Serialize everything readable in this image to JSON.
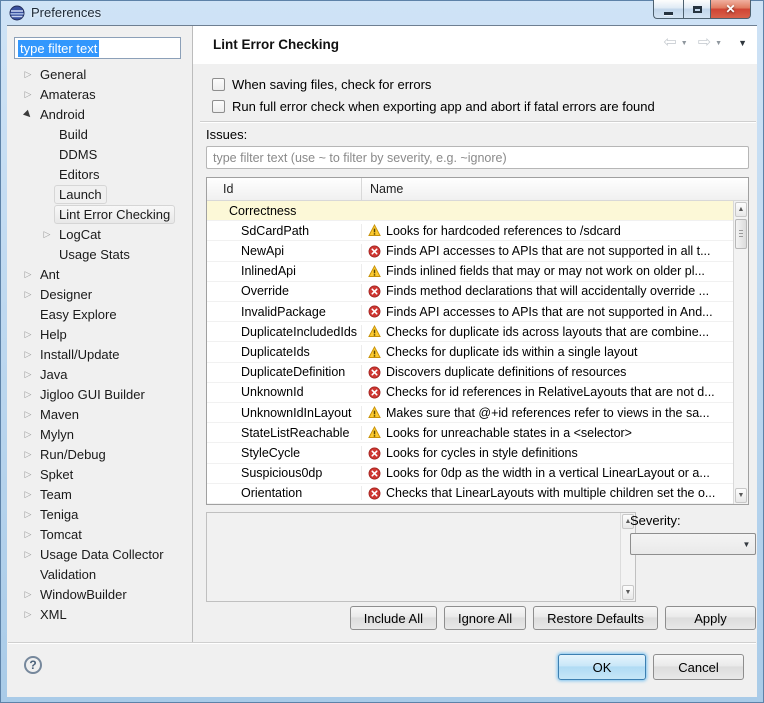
{
  "window": {
    "title": "Preferences"
  },
  "icons": {
    "back": "⇦",
    "forward": "⇨",
    "caret_down": "▼",
    "view_menu": "▼",
    "scroll_up": "▲",
    "scroll_down": "▼",
    "help": "?",
    "close": "✕",
    "tree_collapsed": "▷",
    "tree_expanded": "▶"
  },
  "colors": {
    "selection_blue": "#3297fd",
    "titlebar_blue": "#b0d0ec",
    "category_row": "#fcf8d7",
    "error_red": "#cf3732",
    "warning_amber": "#fdca2f"
  },
  "sidebar": {
    "filter_value": "type filter text",
    "tree": [
      {
        "label": "General",
        "indent": 0,
        "arrow": "collapsed"
      },
      {
        "label": "Amateras",
        "indent": 0,
        "arrow": "collapsed"
      },
      {
        "label": "Android",
        "indent": 0,
        "arrow": "expanded"
      },
      {
        "label": "Build",
        "indent": 1,
        "arrow": "none"
      },
      {
        "label": "DDMS",
        "indent": 1,
        "arrow": "none"
      },
      {
        "label": "Editors",
        "indent": 1,
        "arrow": "none"
      },
      {
        "label": "Launch",
        "indent": 1,
        "arrow": "none",
        "state": "focused"
      },
      {
        "label": "Lint Error Checking",
        "indent": 1,
        "arrow": "none",
        "state": "selected"
      },
      {
        "label": "LogCat",
        "indent": 1,
        "arrow": "collapsed"
      },
      {
        "label": "Usage Stats",
        "indent": 1,
        "arrow": "none"
      },
      {
        "label": "Ant",
        "indent": 0,
        "arrow": "collapsed"
      },
      {
        "label": "Designer",
        "indent": 0,
        "arrow": "collapsed"
      },
      {
        "label": "Easy Explore",
        "indent": 0,
        "arrow": "none"
      },
      {
        "label": "Help",
        "indent": 0,
        "arrow": "collapsed"
      },
      {
        "label": "Install/Update",
        "indent": 0,
        "arrow": "collapsed"
      },
      {
        "label": "Java",
        "indent": 0,
        "arrow": "collapsed"
      },
      {
        "label": "Jigloo GUI Builder",
        "indent": 0,
        "arrow": "collapsed"
      },
      {
        "label": "Maven",
        "indent": 0,
        "arrow": "collapsed"
      },
      {
        "label": "Mylyn",
        "indent": 0,
        "arrow": "collapsed"
      },
      {
        "label": "Run/Debug",
        "indent": 0,
        "arrow": "collapsed"
      },
      {
        "label": "Spket",
        "indent": 0,
        "arrow": "collapsed"
      },
      {
        "label": "Team",
        "indent": 0,
        "arrow": "collapsed"
      },
      {
        "label": "Teniga",
        "indent": 0,
        "arrow": "collapsed"
      },
      {
        "label": "Tomcat",
        "indent": 0,
        "arrow": "collapsed"
      },
      {
        "label": "Usage Data Collector",
        "indent": 0,
        "arrow": "collapsed"
      },
      {
        "label": "Validation",
        "indent": 0,
        "arrow": "none"
      },
      {
        "label": "WindowBuilder",
        "indent": 0,
        "arrow": "collapsed"
      },
      {
        "label": "XML",
        "indent": 0,
        "arrow": "collapsed"
      }
    ]
  },
  "main": {
    "title": "Lint Error Checking",
    "checkboxes": [
      {
        "label": "When saving files, check for errors",
        "checked": false
      },
      {
        "label": "Run full error check when exporting app and abort if fatal errors are found",
        "checked": false
      }
    ],
    "issues_label": "Issues:",
    "issues_filter_placeholder": "type filter text (use ~ to filter by severity, e.g. ~ignore)",
    "table": {
      "columns": [
        "Id",
        "Name"
      ],
      "rows": [
        {
          "id": "Correctness",
          "category": true,
          "name": ""
        },
        {
          "id": "SdCardPath",
          "severity": "warning",
          "name": "Looks for hardcoded references to /sdcard"
        },
        {
          "id": "NewApi",
          "severity": "error",
          "name": "Finds API accesses to APIs that are not supported in all t..."
        },
        {
          "id": "InlinedApi",
          "severity": "warning",
          "name": "Finds inlined fields that may or may not work on older pl..."
        },
        {
          "id": "Override",
          "severity": "error",
          "name": "Finds method declarations that will accidentally override ..."
        },
        {
          "id": "InvalidPackage",
          "severity": "error",
          "name": "Finds API accesses to APIs that are not supported in And..."
        },
        {
          "id": "DuplicateIncludedIds",
          "severity": "warning",
          "name": "Checks for duplicate ids across layouts that are combine..."
        },
        {
          "id": "DuplicateIds",
          "severity": "warning",
          "name": "Checks for duplicate ids within a single layout"
        },
        {
          "id": "DuplicateDefinition",
          "severity": "error",
          "name": "Discovers duplicate definitions of resources"
        },
        {
          "id": "UnknownId",
          "severity": "error",
          "name": "Checks for id references in RelativeLayouts that are not d..."
        },
        {
          "id": "UnknownIdInLayout",
          "severity": "warning",
          "name": "Makes sure that @+id references refer to views in the sa..."
        },
        {
          "id": "StateListReachable",
          "severity": "warning",
          "name": "Looks for unreachable states in a <selector>"
        },
        {
          "id": "StyleCycle",
          "severity": "error",
          "name": "Looks for cycles in style definitions"
        },
        {
          "id": "Suspicious0dp",
          "severity": "error",
          "name": "Looks for 0dp as the width in a vertical LinearLayout or a..."
        },
        {
          "id": "Orientation",
          "severity": "error",
          "name": "Checks that LinearLayouts with multiple children set the o..."
        }
      ]
    },
    "severity_label": "Severity:",
    "severity_value": "",
    "action_buttons": [
      "Include All",
      "Ignore All",
      "Restore Defaults",
      "Apply"
    ]
  },
  "footer": {
    "ok": "OK",
    "cancel": "Cancel"
  }
}
